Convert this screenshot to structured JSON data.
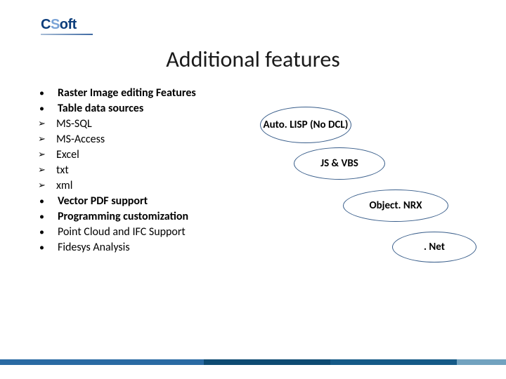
{
  "logo": {
    "c": "C",
    "s": "S",
    "oft": "oft"
  },
  "title": "Additional features",
  "list": [
    {
      "bullet": "dot",
      "text": "Raster Image editing Features",
      "bold": true
    },
    {
      "bullet": "dot",
      "text": "Table data sources",
      "bold": true
    },
    {
      "bullet": "arrow",
      "text": "MS-SQL",
      "bold": false
    },
    {
      "bullet": "arrow",
      "text": "MS-Access",
      "bold": false
    },
    {
      "bullet": "arrow",
      "text": "Excel",
      "bold": false
    },
    {
      "bullet": "arrow",
      "text": "txt",
      "bold": false
    },
    {
      "bullet": "arrow",
      "text": "xml",
      "bold": false
    },
    {
      "bullet": "dot",
      "text": "Vector PDF support",
      "bold": true
    },
    {
      "bullet": "dot",
      "text": "Programming customization",
      "bold": true
    },
    {
      "bullet": "dot",
      "text": "Point Cloud and IFC Support",
      "bold": false
    },
    {
      "bullet": "dot",
      "text": "Fidesys Analysis",
      "bold": false
    }
  ],
  "ovals": {
    "a": "Auto. LISP (No DCL)",
    "b": "JS & VBS",
    "c": "Object. NRX",
    "d": ". Net"
  }
}
